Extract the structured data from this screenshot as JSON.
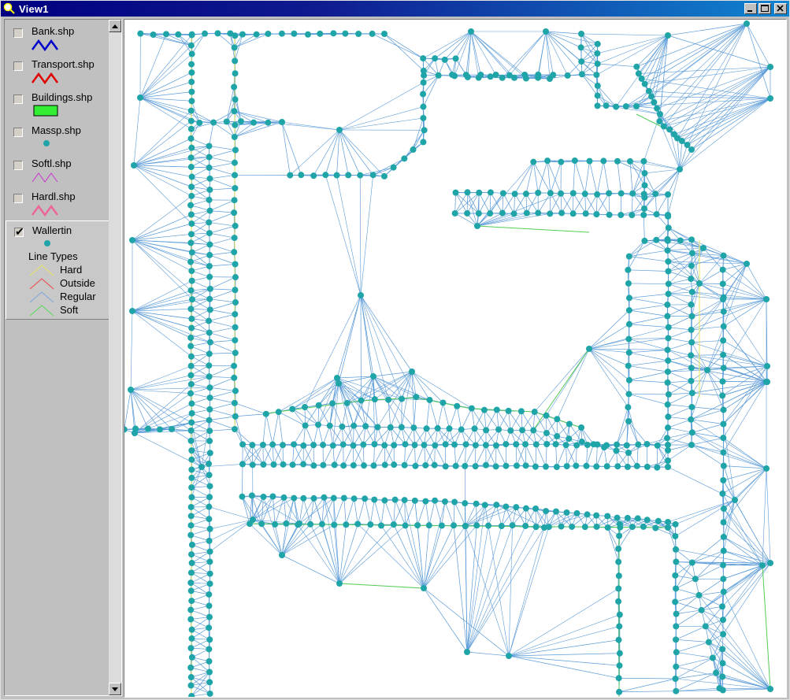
{
  "window": {
    "title": "View1",
    "controls": [
      "minimize-icon",
      "maximize-icon",
      "close-icon"
    ]
  },
  "legend": {
    "themes": [
      {
        "name": "Bank.shp",
        "checked": false,
        "symbol": "line",
        "color": "#0000cc"
      },
      {
        "name": "Transport.shp",
        "checked": false,
        "symbol": "line",
        "color": "#e00000"
      },
      {
        "name": "Buildings.shp",
        "checked": false,
        "symbol": "polygon",
        "color": "#33ee33"
      },
      {
        "name": "Massp.shp",
        "checked": false,
        "symbol": "point",
        "color": "#1fa5a8"
      },
      {
        "name": "Softl.shp",
        "checked": false,
        "symbol": "line",
        "color": "#cc33cc"
      },
      {
        "name": "Hardl.shp",
        "checked": false,
        "symbol": "line",
        "color": "#ee6699"
      },
      {
        "name": "Wallertin",
        "checked": true,
        "symbol": "point",
        "color": "#1fa5a8"
      }
    ],
    "line_types": {
      "heading": "Line Types",
      "items": [
        {
          "label": "Hard",
          "color": "#e8e85a"
        },
        {
          "label": "Outside",
          "color": "#ee4444"
        },
        {
          "label": "Regular",
          "color": "#7aa7dd"
        },
        {
          "label": "Soft",
          "color": "#55dd55"
        }
      ]
    }
  },
  "map": {
    "background": "#ffffff",
    "regular_edge_color": "#5b9bd8",
    "soft_edge_color": "#55cc55",
    "hard_edge_color": "#e6e65a",
    "node_color": "#1fa5a8"
  }
}
